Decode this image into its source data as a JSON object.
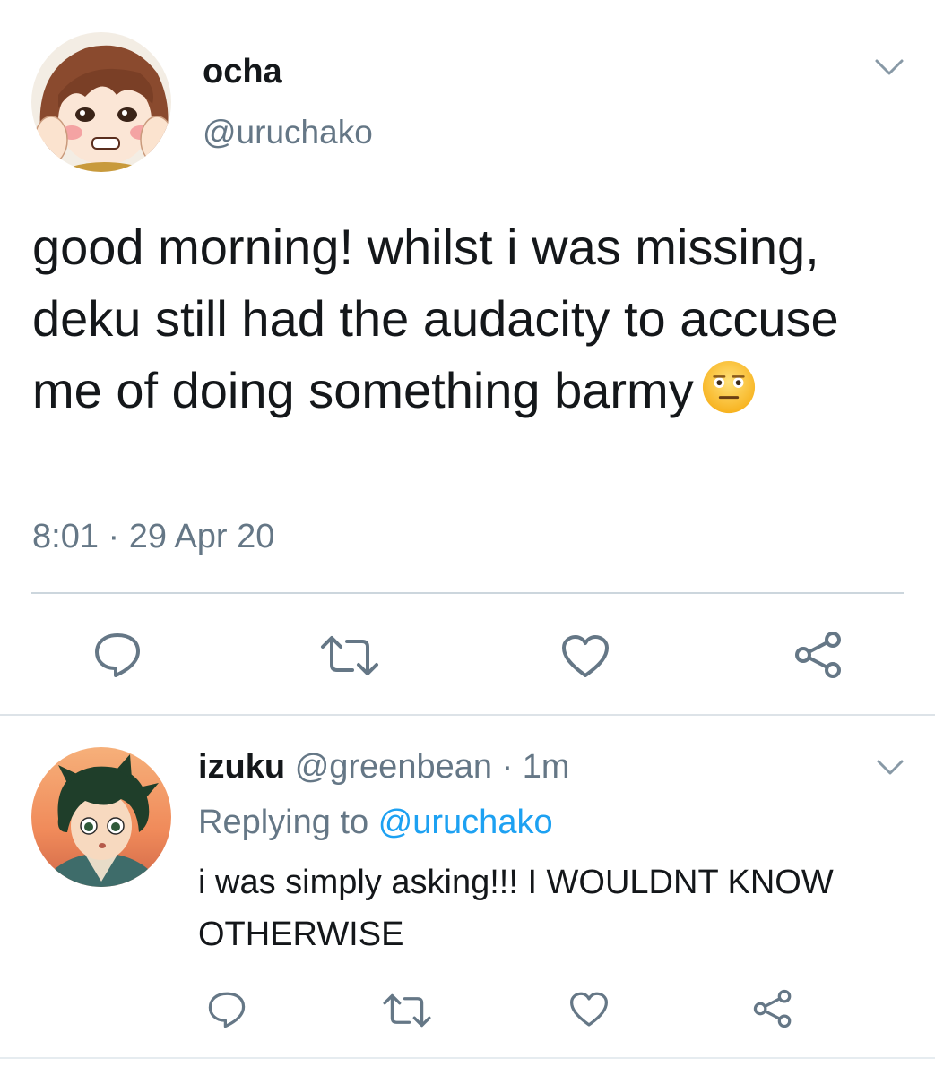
{
  "main_tweet": {
    "display_name": "ocha",
    "handle": "@uruchako",
    "text": "good morning! whilst i was missing, deku still had the audacity to accuse me of doing something barmy",
    "emoji": "neutral-face-emoji",
    "timestamp": "8:01 · 29 Apr 20"
  },
  "reply": {
    "display_name": "izuku",
    "handle": "@greenbean",
    "meta": "· 1m",
    "replying_label": "Replying to",
    "replying_to": "@uruchako",
    "text": "i was simply asking!!! I WOULDNT KNOW OTHERWISE"
  },
  "actions": [
    "reply-icon",
    "retweet-icon",
    "like-icon",
    "share-icon"
  ],
  "colors": {
    "text": "#14171a",
    "secondary": "#657786",
    "link": "#1da1f2",
    "divider": "#ccd6dd"
  }
}
